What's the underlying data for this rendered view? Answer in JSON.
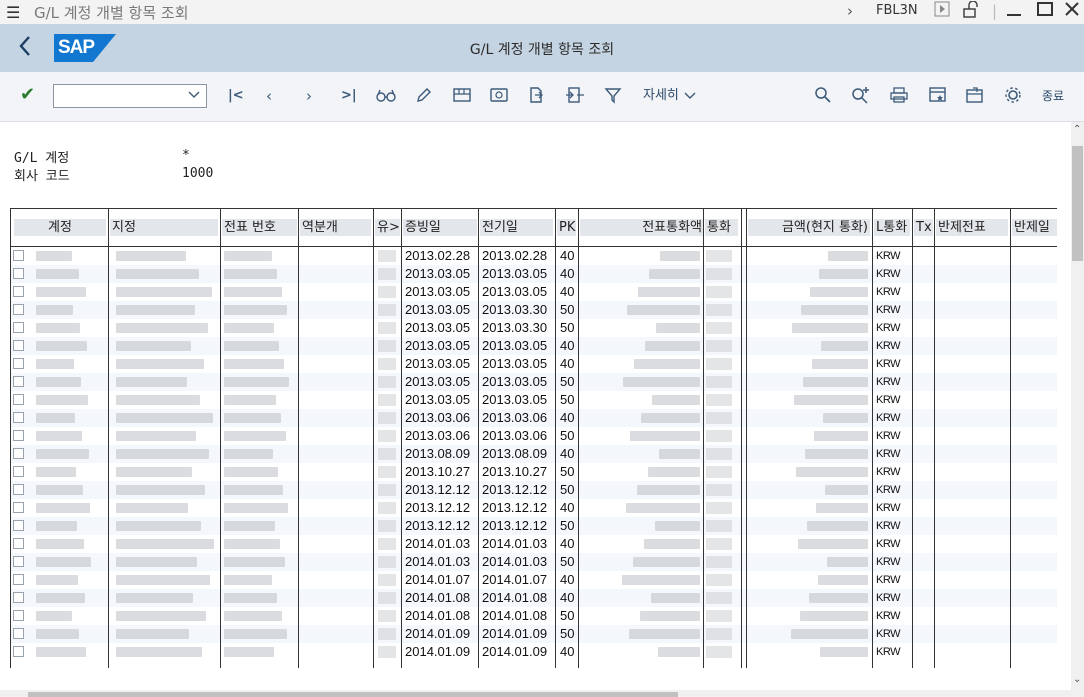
{
  "window": {
    "title": "G/L 계정 개별 항목 조회",
    "transaction": "FBL3N"
  },
  "header": {
    "title": "G/L 계정 개별 항목 조회"
  },
  "toolbar": {
    "command_value": "",
    "details_label": "자세히",
    "exit_label": "종료"
  },
  "selection": [
    {
      "label": "G/L 계정",
      "value": "*"
    },
    {
      "label": "회사 코드",
      "value": "1000"
    }
  ],
  "table": {
    "columns": [
      "계정",
      "지정",
      "전표 번호",
      "역분개",
      "유>",
      "증빙일",
      "전기일",
      "PK",
      "전표통화액",
      "통화",
      "금액(현지 통화)",
      "L통화",
      "Tx",
      "반제전표",
      "반제일"
    ],
    "rows": [
      {
        "doc_date": "2013.02.28",
        "post_date": "2013.02.28",
        "pk": "40",
        "lcurr": "KRW"
      },
      {
        "doc_date": "2013.03.05",
        "post_date": "2013.03.05",
        "pk": "40",
        "lcurr": "KRW"
      },
      {
        "doc_date": "2013.03.05",
        "post_date": "2013.03.05",
        "pk": "40",
        "lcurr": "KRW"
      },
      {
        "doc_date": "2013.03.05",
        "post_date": "2013.03.30",
        "pk": "50",
        "lcurr": "KRW"
      },
      {
        "doc_date": "2013.03.05",
        "post_date": "2013.03.30",
        "pk": "50",
        "lcurr": "KRW"
      },
      {
        "doc_date": "2013.03.05",
        "post_date": "2013.03.05",
        "pk": "40",
        "lcurr": "KRW"
      },
      {
        "doc_date": "2013.03.05",
        "post_date": "2013.03.05",
        "pk": "40",
        "lcurr": "KRW"
      },
      {
        "doc_date": "2013.03.05",
        "post_date": "2013.03.05",
        "pk": "50",
        "lcurr": "KRW"
      },
      {
        "doc_date": "2013.03.05",
        "post_date": "2013.03.05",
        "pk": "50",
        "lcurr": "KRW"
      },
      {
        "doc_date": "2013.03.06",
        "post_date": "2013.03.06",
        "pk": "40",
        "lcurr": "KRW"
      },
      {
        "doc_date": "2013.03.06",
        "post_date": "2013.03.06",
        "pk": "50",
        "lcurr": "KRW"
      },
      {
        "doc_date": "2013.08.09",
        "post_date": "2013.08.09",
        "pk": "40",
        "lcurr": "KRW"
      },
      {
        "doc_date": "2013.10.27",
        "post_date": "2013.10.27",
        "pk": "50",
        "lcurr": "KRW"
      },
      {
        "doc_date": "2013.12.12",
        "post_date": "2013.12.12",
        "pk": "50",
        "lcurr": "KRW"
      },
      {
        "doc_date": "2013.12.12",
        "post_date": "2013.12.12",
        "pk": "40",
        "lcurr": "KRW"
      },
      {
        "doc_date": "2013.12.12",
        "post_date": "2013.12.12",
        "pk": "50",
        "lcurr": "KRW"
      },
      {
        "doc_date": "2014.01.03",
        "post_date": "2014.01.03",
        "pk": "40",
        "lcurr": "KRW"
      },
      {
        "doc_date": "2014.01.03",
        "post_date": "2014.01.03",
        "pk": "50",
        "lcurr": "KRW"
      },
      {
        "doc_date": "2014.01.07",
        "post_date": "2014.01.07",
        "pk": "40",
        "lcurr": "KRW"
      },
      {
        "doc_date": "2014.01.08",
        "post_date": "2014.01.08",
        "pk": "40",
        "lcurr": "KRW"
      },
      {
        "doc_date": "2014.01.08",
        "post_date": "2014.01.08",
        "pk": "50",
        "lcurr": "KRW"
      },
      {
        "doc_date": "2014.01.09",
        "post_date": "2014.01.09",
        "pk": "50",
        "lcurr": "KRW"
      },
      {
        "doc_date": "2014.01.09",
        "post_date": "2014.01.09",
        "pk": "40",
        "lcurr": "KRW"
      }
    ]
  },
  "colors": {
    "header_bg": "#c5d4e2",
    "sap_blue": "#1177d0",
    "accept_green": "#2b7d2b"
  },
  "icons": [
    "menu-icon",
    "chevron-right-icon",
    "play-icon",
    "unlock-icon",
    "minimize-icon",
    "maximize-icon",
    "close-icon",
    "back-arrow-icon",
    "check-icon",
    "first-page-icon",
    "prev-page-icon",
    "next-page-icon",
    "last-page-icon",
    "glasses-icon",
    "pencil-icon",
    "layout-icon",
    "money-icon",
    "export-icon",
    "transfer-icon",
    "filter-icon",
    "search-icon",
    "search-next-icon",
    "print-icon",
    "layout-save-icon",
    "subwindow-icon",
    "settings-icon"
  ]
}
